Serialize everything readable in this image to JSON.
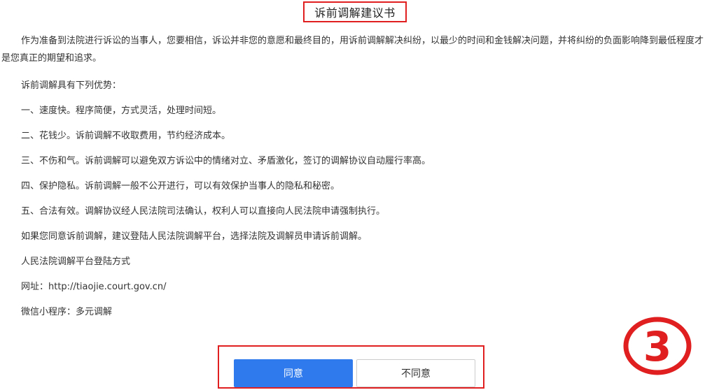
{
  "document": {
    "title": "诉前调解建议书",
    "intro": "作为准备到法院进行诉讼的当事人，您要相信，诉讼并非您的意愿和最终目的，用诉前调解解决纠纷，以最少的时间和金钱解决问题，并将纠纷的负面影响降到最低程度才是您真正的期望和追求。",
    "advantages_heading": "诉前调解具有下列优势：",
    "advantages": [
      "一、速度快。程序简便，方式灵活，处理时间短。",
      "二、花钱少。诉前调解不收取费用，节约经济成本。",
      "三、不伤和气。诉前调解可以避免双方诉讼中的情绪对立、矛盾激化，签订的调解协议自动履行率高。",
      "四、保护隐私。诉前调解一般不公开进行，可以有效保护当事人的隐私和秘密。",
      "五、合法有效。调解协议经人民法院司法确认，权利人可以直接向人民法院申请强制执行。"
    ],
    "suggestion": "如果您同意诉前调解，建议登陆人民法院调解平台，选择法院及调解员申请诉前调解。",
    "platform_heading": "人民法院调解平台登陆方式",
    "website": "网址：http://tiaojie.court.gov.cn/",
    "mini_program": "微信小程序：多元调解"
  },
  "actions": {
    "agree_label": "同意",
    "disagree_label": "不同意"
  },
  "annotation": {
    "step_number": "3"
  },
  "colors": {
    "highlight_red": "#e02020",
    "primary_blue": "#2f7bed"
  }
}
